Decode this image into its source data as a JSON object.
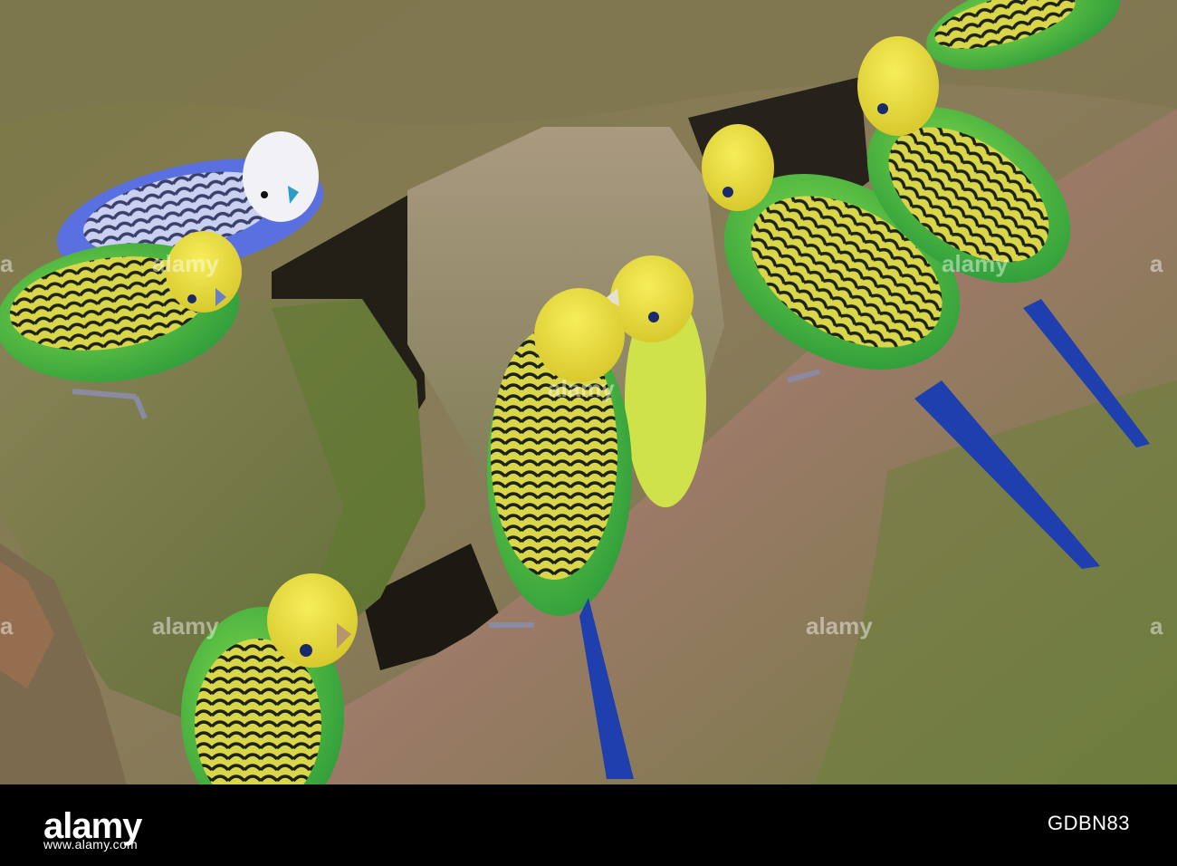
{
  "photo": {
    "subject": "budgerigars-on-rocks",
    "palette": {
      "rock_moss": "#6f7a3f",
      "rock_pink": "#b58a7a",
      "rock_dark": "#4a4a30",
      "crevice": "#1e1b14",
      "green_body": "#3cb043",
      "yellow_head": "#e8e03a",
      "blue_body": "#5a6fe0",
      "tail_blue": "#1f3fae"
    },
    "watermarks": [
      "a",
      "a",
      "a",
      "a",
      "alamy",
      "alamy",
      "alamy",
      "alamy",
      "alamy"
    ]
  },
  "footer": {
    "logo": "alamy",
    "site": "www.alamy.com",
    "image_id": "GDBN83"
  }
}
